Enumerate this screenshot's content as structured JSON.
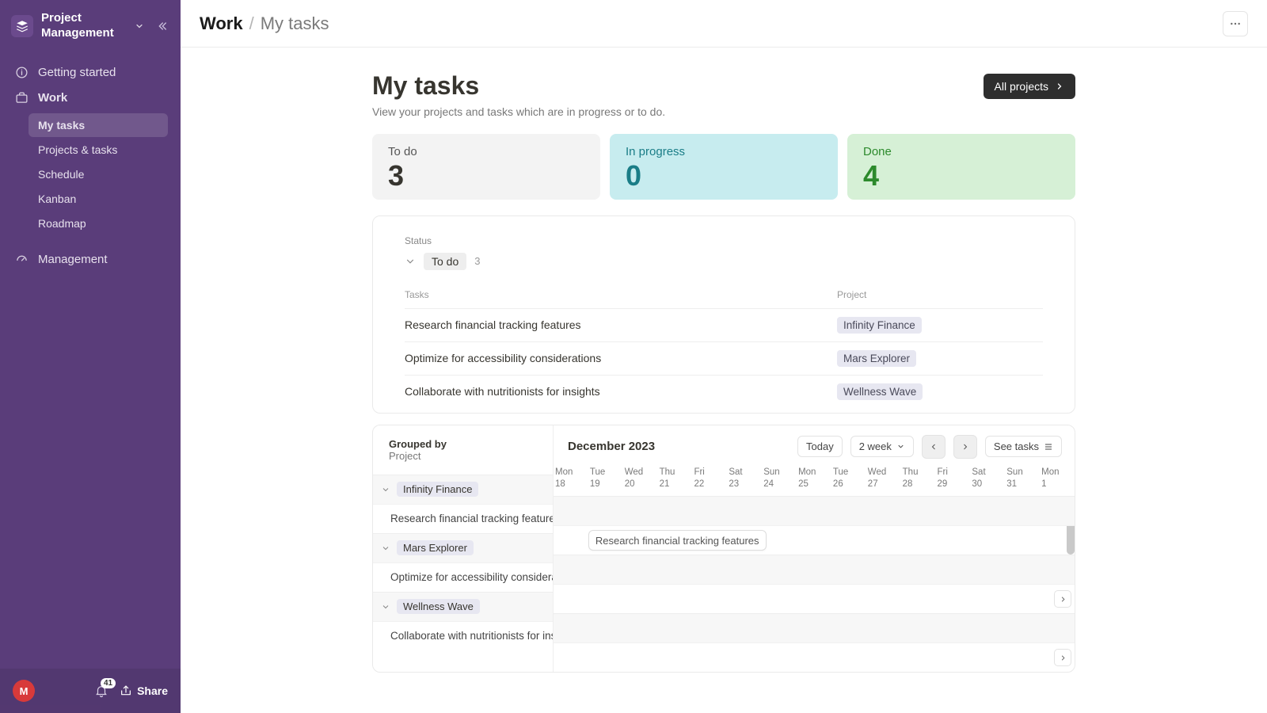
{
  "workspace": {
    "name": "Project Management"
  },
  "sidebar": {
    "items": [
      {
        "label": "Getting started"
      },
      {
        "label": "Work"
      },
      {
        "label": "Management"
      }
    ],
    "work_children": [
      {
        "label": "My tasks",
        "active": true
      },
      {
        "label": "Projects & tasks"
      },
      {
        "label": "Schedule"
      },
      {
        "label": "Kanban"
      },
      {
        "label": "Roadmap"
      }
    ],
    "avatar_initial": "M",
    "notification_count": "41",
    "share_label": "Share"
  },
  "breadcrumb": {
    "root": "Work",
    "sep": "/",
    "leaf": "My tasks"
  },
  "page": {
    "title": "My tasks",
    "subtitle": "View your projects and tasks which are in progress or to do.",
    "all_projects_label": "All projects"
  },
  "stats": {
    "todo_label": "To do",
    "todo_value": "3",
    "progress_label": "In progress",
    "progress_value": "0",
    "done_label": "Done",
    "done_value": "4"
  },
  "status_group": {
    "status_eyebrow": "Status",
    "status_pill": "To do",
    "status_count": "3",
    "col_tasks": "Tasks",
    "col_project": "Project",
    "rows": [
      {
        "task": "Research financial tracking features",
        "project": "Infinity Finance"
      },
      {
        "task": "Optimize for accessibility considerations",
        "project": "Mars Explorer"
      },
      {
        "task": "Collaborate with nutritionists for insights",
        "project": "Wellness Wave"
      }
    ]
  },
  "timeline": {
    "grouped_by_label": "Grouped by",
    "grouped_by_value": "Project",
    "month_label": "December 2023",
    "today_label": "Today",
    "range_label": "2 week",
    "see_tasks_label": "See tasks",
    "days": [
      {
        "dow": "Mon",
        "num": "18"
      },
      {
        "dow": "Tue",
        "num": "19"
      },
      {
        "dow": "Wed",
        "num": "20"
      },
      {
        "dow": "Thu",
        "num": "21"
      },
      {
        "dow": "Fri",
        "num": "22"
      },
      {
        "dow": "Sat",
        "num": "23"
      },
      {
        "dow": "Sun",
        "num": "24"
      },
      {
        "dow": "Mon",
        "num": "25"
      },
      {
        "dow": "Tue",
        "num": "26"
      },
      {
        "dow": "Wed",
        "num": "27"
      },
      {
        "dow": "Thu",
        "num": "28"
      },
      {
        "dow": "Fri",
        "num": "29"
      },
      {
        "dow": "Sat",
        "num": "30"
      },
      {
        "dow": "Sun",
        "num": "31"
      },
      {
        "dow": "Mon",
        "num": "1"
      }
    ],
    "groups": [
      {
        "name": "Infinity Finance",
        "task": "Research financial tracking features",
        "bar_label": "Research financial tracking features",
        "bar_start": 1,
        "bar_span": 1,
        "has_arrow": false
      },
      {
        "name": "Mars Explorer",
        "task": "Optimize for accessibility considerations",
        "bar_label": "",
        "has_arrow": true
      },
      {
        "name": "Wellness Wave",
        "task": "Collaborate with nutritionists for insights",
        "bar_label": "",
        "has_arrow": true
      }
    ]
  }
}
